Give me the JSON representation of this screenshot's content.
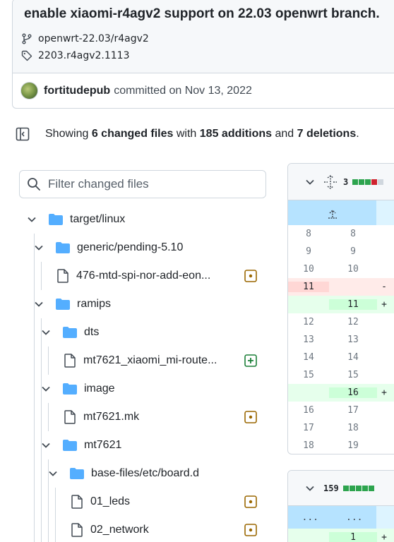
{
  "commit": {
    "title": "enable xiaomi-r4agv2 support on 22.03 openwrt branch.",
    "branch": "openwrt-22.03/r4agv2",
    "tag": "2203.r4agv2.1113",
    "author": "fortitudepub",
    "committed_text": "committed on Nov 13, 2022"
  },
  "summary": {
    "prefix": "Showing",
    "files": "6 changed files",
    "mid1": "with",
    "additions": "185 additions",
    "mid2": "and",
    "deletions": "7 deletions",
    "suffix": "."
  },
  "filter": {
    "placeholder": "Filter changed files"
  },
  "tree": [
    {
      "label": "target/linux",
      "type": "folder"
    },
    {
      "label": "generic/pending-5.10",
      "type": "folder"
    },
    {
      "label": "476-mtd-spi-nor-add-eon...",
      "type": "file",
      "status": "modified"
    },
    {
      "label": "ramips",
      "type": "folder"
    },
    {
      "label": "dts",
      "type": "folder"
    },
    {
      "label": "mt7621_xiaomi_mi-route...",
      "type": "file",
      "status": "added"
    },
    {
      "label": "image",
      "type": "folder"
    },
    {
      "label": "mt7621.mk",
      "type": "file",
      "status": "modified"
    },
    {
      "label": "mt7621",
      "type": "folder"
    },
    {
      "label": "base-files/etc/board.d",
      "type": "folder"
    },
    {
      "label": "01_leds",
      "type": "file",
      "status": "modified"
    },
    {
      "label": "02_network",
      "type": "file",
      "status": "modified"
    }
  ],
  "diff1": {
    "count": "3",
    "diffstat_colors": [
      "#2da44e",
      "#2da44e",
      "#2da44e",
      "#cf222e",
      "#d0d7de"
    ],
    "lines": [
      {
        "old": "8",
        "new": "8",
        "mark": "",
        "kind": "ctx"
      },
      {
        "old": "9",
        "new": "9",
        "mark": "",
        "kind": "ctx"
      },
      {
        "old": "10",
        "new": "10",
        "mark": "",
        "kind": "ctx"
      },
      {
        "old": "11",
        "new": "",
        "mark": "-",
        "kind": "del"
      },
      {
        "old": "",
        "new": "11",
        "mark": "+",
        "kind": "add"
      },
      {
        "old": "12",
        "new": "12",
        "mark": "",
        "kind": "ctx"
      },
      {
        "old": "13",
        "new": "13",
        "mark": "",
        "kind": "ctx"
      },
      {
        "old": "14",
        "new": "14",
        "mark": "",
        "kind": "ctx"
      },
      {
        "old": "15",
        "new": "15",
        "mark": "",
        "kind": "ctx"
      },
      {
        "old": "",
        "new": "16",
        "mark": "+",
        "kind": "add"
      },
      {
        "old": "16",
        "new": "17",
        "mark": "",
        "kind": "ctx"
      },
      {
        "old": "17",
        "new": "18",
        "mark": "",
        "kind": "ctx"
      },
      {
        "old": "18",
        "new": "19",
        "mark": "",
        "kind": "ctx"
      }
    ]
  },
  "diff2": {
    "count": "159",
    "diffstat_colors": [
      "#2da44e",
      "#2da44e",
      "#2da44e",
      "#2da44e",
      "#2da44e"
    ],
    "hunk_left": "...",
    "hunk_right": "...",
    "first_new": "1",
    "first_mark": "+"
  },
  "colors": {
    "folder": "#54aeff",
    "modified": "#9a6700",
    "added": "#1a7f37",
    "deleted": "#cf222e"
  }
}
